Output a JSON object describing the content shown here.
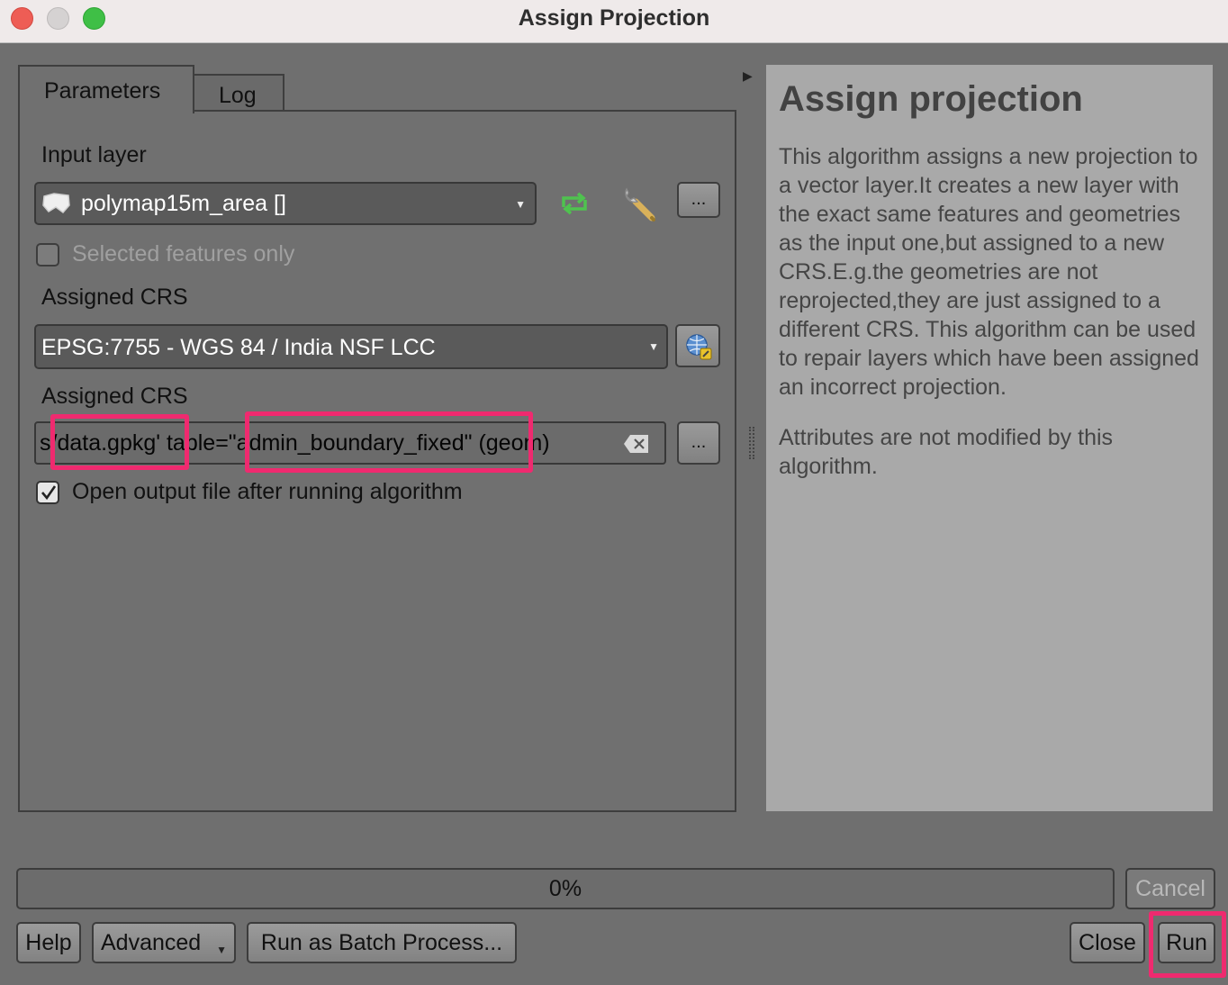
{
  "window": {
    "title": "Assign Projection"
  },
  "tabs": {
    "parameters": "Parameters",
    "log": "Log"
  },
  "form": {
    "input_layer_label": "Input layer",
    "input_layer_value": "polymap15m_area []",
    "selected_only_label": "Selected features only",
    "crs_label": "Assigned CRS",
    "crs_value": "EPSG:7755 - WGS 84 / India NSF LCC",
    "output_label": "Assigned CRS",
    "output_value": "s/data.gpkg' table=\"admin_boundary_fixed\" (geom)",
    "open_output_label": "Open output file after running algorithm",
    "open_output_checked": true,
    "browse_label": "..."
  },
  "help": {
    "title": "Assign projection",
    "paragraph1": "This algorithm assigns a new projection to a vector layer.It creates a new layer with the exact same features and geometries as the input one,but assigned to a new CRS.E.g.the geometries are not reprojected,they are just assigned to a different CRS. This algorithm can be used to repair layers which have been assigned an incorrect projection.",
    "paragraph2": "Attributes are not modified by this algorithm."
  },
  "progress": {
    "value": "0%"
  },
  "buttons": {
    "cancel": "Cancel",
    "help": "Help",
    "advanced": "Advanced",
    "batch": "Run as Batch Process...",
    "close": "Close",
    "run": "Run"
  },
  "colors": {
    "highlight": "#ef2a6f",
    "refresh_icon": "#4fc24f"
  },
  "icons": [
    "polygon-layer-icon",
    "refresh-icon",
    "wrench-icon",
    "crs-globe-icon",
    "clear-icon",
    "checkmark-icon"
  ]
}
